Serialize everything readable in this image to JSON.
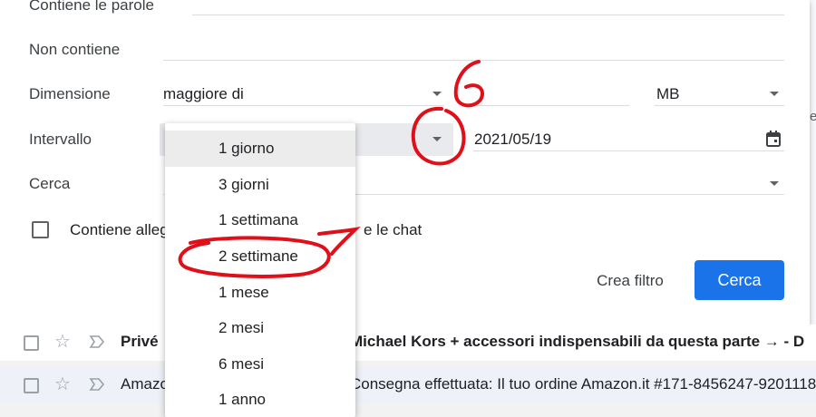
{
  "search_form": {
    "contains_words": {
      "label": "Contiene le parole",
      "value": ""
    },
    "not_contains": {
      "label": "Non contiene",
      "value": ""
    },
    "size": {
      "label": "Dimensione",
      "operator": "maggiore di",
      "value": "",
      "unit": "MB"
    },
    "interval": {
      "label": "Intervallo",
      "selected": "1 giorno",
      "date": "2021/05/19"
    },
    "search_in": {
      "label": "Cerca",
      "value": ""
    },
    "attachment_checkbox": {
      "label_start": "Contiene alleg",
      "label_end": "e le chat",
      "checked": false
    },
    "buttons": {
      "create_filter": "Crea filtro",
      "search": "Cerca"
    }
  },
  "interval_menu": {
    "options": [
      "1 giorno",
      "3 giorni",
      "1 settimana",
      "2 settimane",
      "1 mese",
      "2 mesi",
      "6 mesi",
      "1 anno"
    ],
    "highlighted": "1 giorno"
  },
  "mail_rows": [
    {
      "sender": "Privé",
      "subject": "Michael Kors + accessori indispensabili da questa parte → - D",
      "bold": true
    },
    {
      "sender": "Amazo",
      "subject": "Consegna effettuata: Il tuo ordine Amazon.it #171-8456247-9201118",
      "bold": false
    }
  ],
  "annotations": {
    "step6": "6",
    "step7": "7",
    "color": "#e0101a"
  },
  "colors": {
    "primary_button": "#1a73e8",
    "selected_item": "#ececec",
    "select_field": "#e8eaed"
  }
}
